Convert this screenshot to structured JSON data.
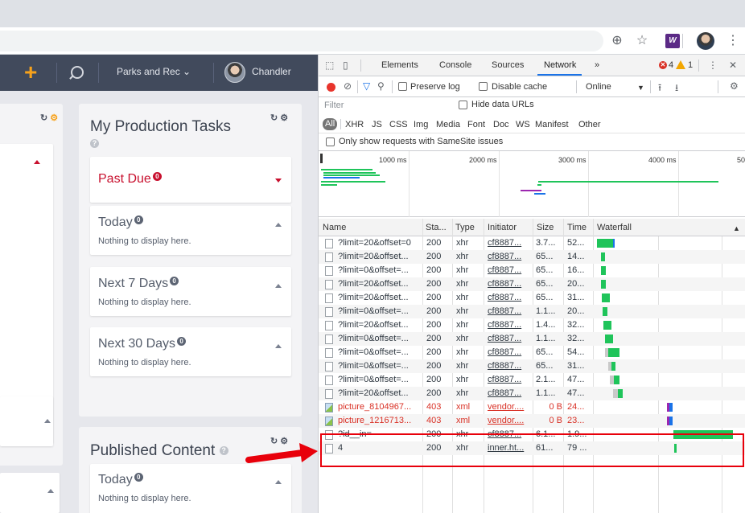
{
  "browser": {
    "zoom_icon": "zoom-icon",
    "star_icon": "star-icon",
    "extension_label": "W",
    "menu_icon": "kebab-icon"
  },
  "app": {
    "header": {
      "add_icon": "+",
      "team": "Parks and Rec",
      "user": "Chandler"
    },
    "production": {
      "title": "My Production Tasks",
      "help": "?",
      "sections": [
        {
          "title": "Past Due",
          "badge": "0",
          "text": ""
        },
        {
          "title": "Today",
          "badge": "0",
          "text": "Nothing to display here."
        },
        {
          "title": "Next 7 Days",
          "badge": "0",
          "text": "Nothing to display here."
        },
        {
          "title": "Next 30 Days",
          "badge": "0",
          "text": "Nothing to display here."
        }
      ]
    },
    "published": {
      "title": "Published Content",
      "help": "?",
      "sections": [
        {
          "title": "Today",
          "badge": "0",
          "text": "Nothing to display here."
        }
      ]
    },
    "refresh_icon": "↻",
    "gear_icon": "⚙"
  },
  "devtools": {
    "tabs": [
      "Elements",
      "Console",
      "Sources",
      "Network"
    ],
    "more": "»",
    "error_count": "4",
    "warning_count": "1",
    "toolbar": {
      "preserve_log": "Preserve log",
      "disable_cache": "Disable cache",
      "throttle": "Online"
    },
    "filter_placeholder": "Filter",
    "hide_data_urls": "Hide data URLs",
    "types": [
      "All",
      "XHR",
      "JS",
      "CSS",
      "Img",
      "Media",
      "Font",
      "Doc",
      "WS",
      "Manifest",
      "Other"
    ],
    "samesite": "Only show requests with SameSite issues",
    "overview_labels": [
      "1000 ms",
      "2000 ms",
      "3000 ms",
      "4000 ms",
      "500"
    ],
    "columns": [
      "Name",
      "Sta...",
      "Type",
      "Initiator",
      "Size",
      "Time",
      "Waterfall"
    ],
    "requests": [
      {
        "name": "?limit=20&offset=0",
        "status": "200",
        "type": "xhr",
        "initiator": "cf8887...",
        "size": "3.7...",
        "time": "52...",
        "kind": "doc"
      },
      {
        "name": "?limit=20&offset...",
        "status": "200",
        "type": "xhr",
        "initiator": "cf8887...",
        "size": "65...",
        "time": "14...",
        "kind": "doc"
      },
      {
        "name": "?limit=0&offset=...",
        "status": "200",
        "type": "xhr",
        "initiator": "cf8887...",
        "size": "65...",
        "time": "16...",
        "kind": "doc"
      },
      {
        "name": "?limit=20&offset...",
        "status": "200",
        "type": "xhr",
        "initiator": "cf8887...",
        "size": "65...",
        "time": "20...",
        "kind": "doc"
      },
      {
        "name": "?limit=20&offset...",
        "status": "200",
        "type": "xhr",
        "initiator": "cf8887...",
        "size": "65...",
        "time": "31...",
        "kind": "doc"
      },
      {
        "name": "?limit=0&offset=...",
        "status": "200",
        "type": "xhr",
        "initiator": "cf8887...",
        "size": "1.1...",
        "time": "20...",
        "kind": "doc"
      },
      {
        "name": "?limit=20&offset...",
        "status": "200",
        "type": "xhr",
        "initiator": "cf8887...",
        "size": "1.4...",
        "time": "32...",
        "kind": "doc"
      },
      {
        "name": "?limit=0&offset=...",
        "status": "200",
        "type": "xhr",
        "initiator": "cf8887...",
        "size": "1.1...",
        "time": "32...",
        "kind": "doc"
      },
      {
        "name": "?limit=0&offset=...",
        "status": "200",
        "type": "xhr",
        "initiator": "cf8887...",
        "size": "65...",
        "time": "54...",
        "kind": "doc"
      },
      {
        "name": "?limit=0&offset=...",
        "status": "200",
        "type": "xhr",
        "initiator": "cf8887...",
        "size": "65...",
        "time": "31...",
        "kind": "doc"
      },
      {
        "name": "?limit=0&offset=...",
        "status": "200",
        "type": "xhr",
        "initiator": "cf8887...",
        "size": "2.1...",
        "time": "47...",
        "kind": "doc"
      },
      {
        "name": "?limit=20&offset...",
        "status": "200",
        "type": "xhr",
        "initiator": "cf8887...",
        "size": "1.1...",
        "time": "47...",
        "kind": "doc"
      },
      {
        "name": "picture_8104967...",
        "status": "403",
        "type": "xml",
        "initiator": "vendor....",
        "size": "0 B",
        "time": "24...",
        "kind": "img"
      },
      {
        "name": "picture_1216713...",
        "status": "403",
        "type": "xml",
        "initiator": "vendor....",
        "size": "0 B",
        "time": "23...",
        "kind": "img"
      },
      {
        "name": "?id__in=",
        "status": "200",
        "type": "xhr",
        "initiator": "cf8887...",
        "size": "6.1...",
        "time": "1.9...",
        "kind": "doc"
      },
      {
        "name": "4",
        "status": "200",
        "type": "xhr",
        "initiator": "inner.ht...",
        "size": "61...",
        "time": "79 ...",
        "kind": "doc"
      }
    ]
  },
  "colors": {
    "header_bg": "#414a5c",
    "accent": "#f7a21b",
    "alert_red": "#c8102e",
    "annotation_red": "#e8000b",
    "devtools_blue": "#1a73e8",
    "waterfall_green": "#1fc45a",
    "waterfall_blue": "#1a73e8",
    "waterfall_purple": "#9c27b0"
  }
}
